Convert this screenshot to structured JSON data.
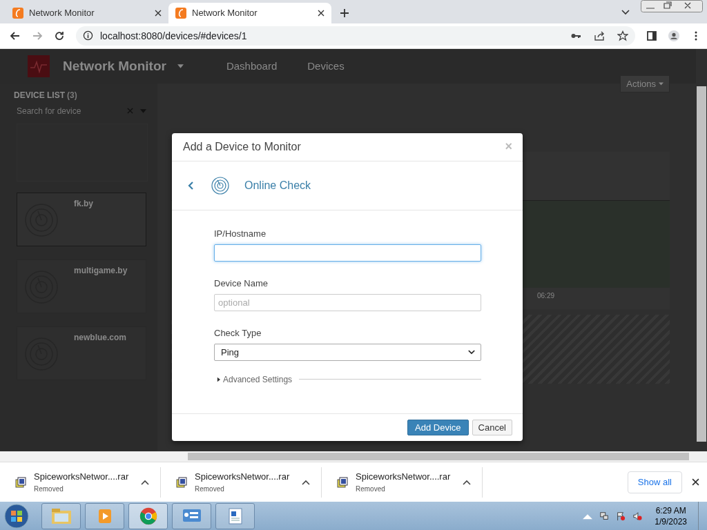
{
  "browser": {
    "tabs": [
      {
        "title": "Network Monitor",
        "selected": false
      },
      {
        "title": "Network Monitor",
        "selected": true
      }
    ],
    "address": "localhost:8080/devices/#devices/1",
    "downloads": [
      {
        "name": "SpiceworksNetwor....rar",
        "status": "Removed"
      },
      {
        "name": "SpiceworksNetwor....rar",
        "status": "Removed"
      },
      {
        "name": "SpiceworksNetwor....rar",
        "status": "Removed"
      }
    ],
    "show_all": "Show all"
  },
  "app": {
    "brand": "Network Monitor",
    "nav": [
      "Dashboard",
      "Devices"
    ],
    "device_list": {
      "title": "DEVICE LIST",
      "count": "(3)",
      "search_placeholder": "Search for device",
      "devices": [
        {
          "name": "fk.by",
          "selected": true
        },
        {
          "name": "multigame.by",
          "selected": false
        },
        {
          "name": "newblue.com",
          "selected": false
        }
      ]
    },
    "actions": "Actions",
    "chart_time": "06:29"
  },
  "modal": {
    "title": "Add a Device to Monitor",
    "close": "×",
    "section": "Online Check",
    "fields": [
      {
        "label": "IP/Hostname",
        "kind": "text",
        "focused": true
      },
      {
        "label": "Device Name",
        "kind": "text",
        "placeholder": "optional",
        "focused": false
      },
      {
        "label": "Check Type",
        "kind": "select",
        "value": "Ping"
      }
    ],
    "advanced": {
      "label": "Advanced Settings",
      "expanded": false
    },
    "buttons": [
      {
        "label": "Add Device",
        "kind": "primary"
      },
      {
        "label": "Cancel",
        "kind": "default"
      }
    ]
  },
  "taskbar": {
    "time": "6:29 AM",
    "date": "1/9/2023"
  }
}
